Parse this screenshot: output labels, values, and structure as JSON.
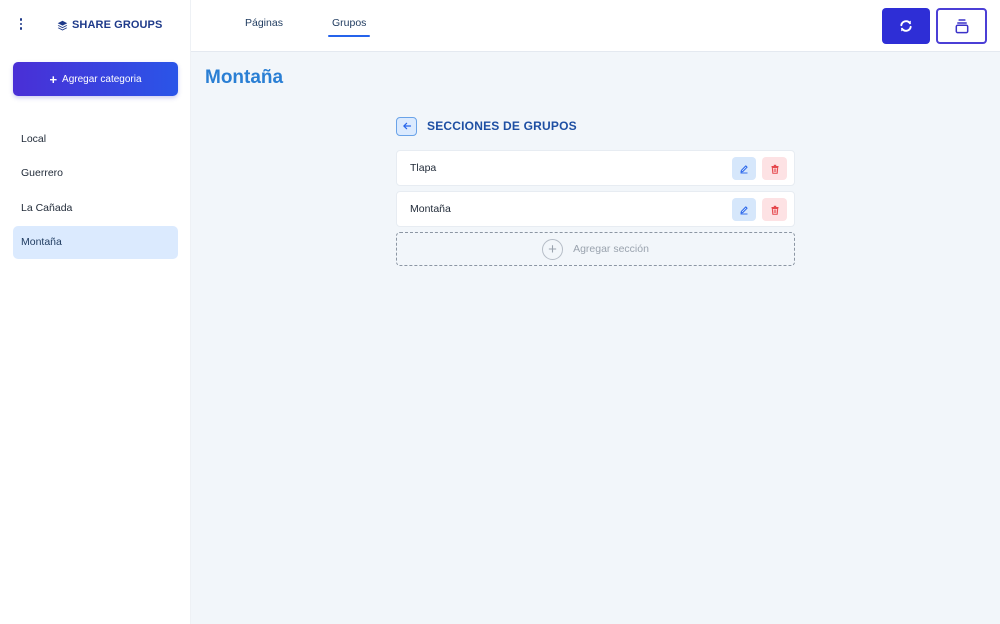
{
  "brand": {
    "title": "SHARE GROUPS",
    "icon": "layers-icon"
  },
  "sidebar": {
    "add_category_label": "Agregar categoria",
    "categories": [
      {
        "label": "Local",
        "active": false
      },
      {
        "label": "Guerrero",
        "active": false
      },
      {
        "label": "La Cañada",
        "active": false
      },
      {
        "label": "Montaña",
        "active": true
      }
    ]
  },
  "topbar": {
    "tabs": [
      {
        "label": "Páginas",
        "active": false
      },
      {
        "label": "Grupos",
        "active": true
      }
    ],
    "refresh_icon": "refresh-icon",
    "stack_icon": "stack-icon"
  },
  "main": {
    "page_title": "Montaña",
    "section_title": "SECCIONES DE GRUPOS",
    "sections": [
      {
        "label": "Tlapa"
      },
      {
        "label": "Montaña"
      }
    ],
    "add_section_label": "Agregar sección"
  },
  "colors": {
    "primary": "#2e2ed6",
    "accent_title": "#2a7fd4",
    "active_bg": "#dbeafe",
    "delete_bg": "#fde2e4",
    "edit_bg": "#d6e7fb"
  }
}
